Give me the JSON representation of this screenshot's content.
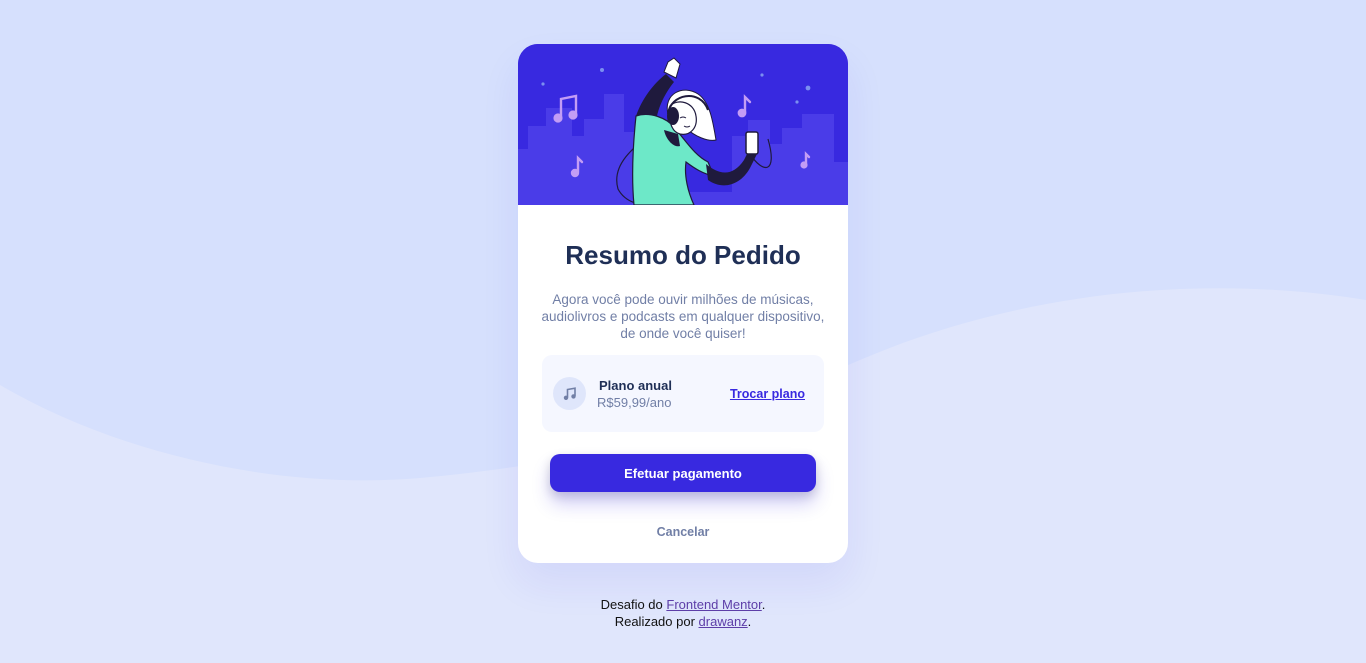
{
  "card": {
    "title": "Resumo do Pedido",
    "description": "Agora você pode ouvir milhões de músicas, audiolivros e podcasts em qualquer dispositivo, de onde você quiser!",
    "plan": {
      "icon": "music-note-icon",
      "name": "Plano anual",
      "price": "R$59,99/ano",
      "change_label": "Trocar plano"
    },
    "pay_label": "Efetuar pagamento",
    "cancel_label": "Cancelar"
  },
  "footer": {
    "line1_prefix": "Desafio do ",
    "line1_link": "Frontend Mentor",
    "line1_suffix": ".",
    "line2_prefix": "Realizado por ",
    "line2_link": "drawanz",
    "line2_suffix": "."
  },
  "colors": {
    "background": "#d6e0fd",
    "accent": "#3829e0",
    "title": "#1f2f56",
    "muted": "#717fa6"
  }
}
